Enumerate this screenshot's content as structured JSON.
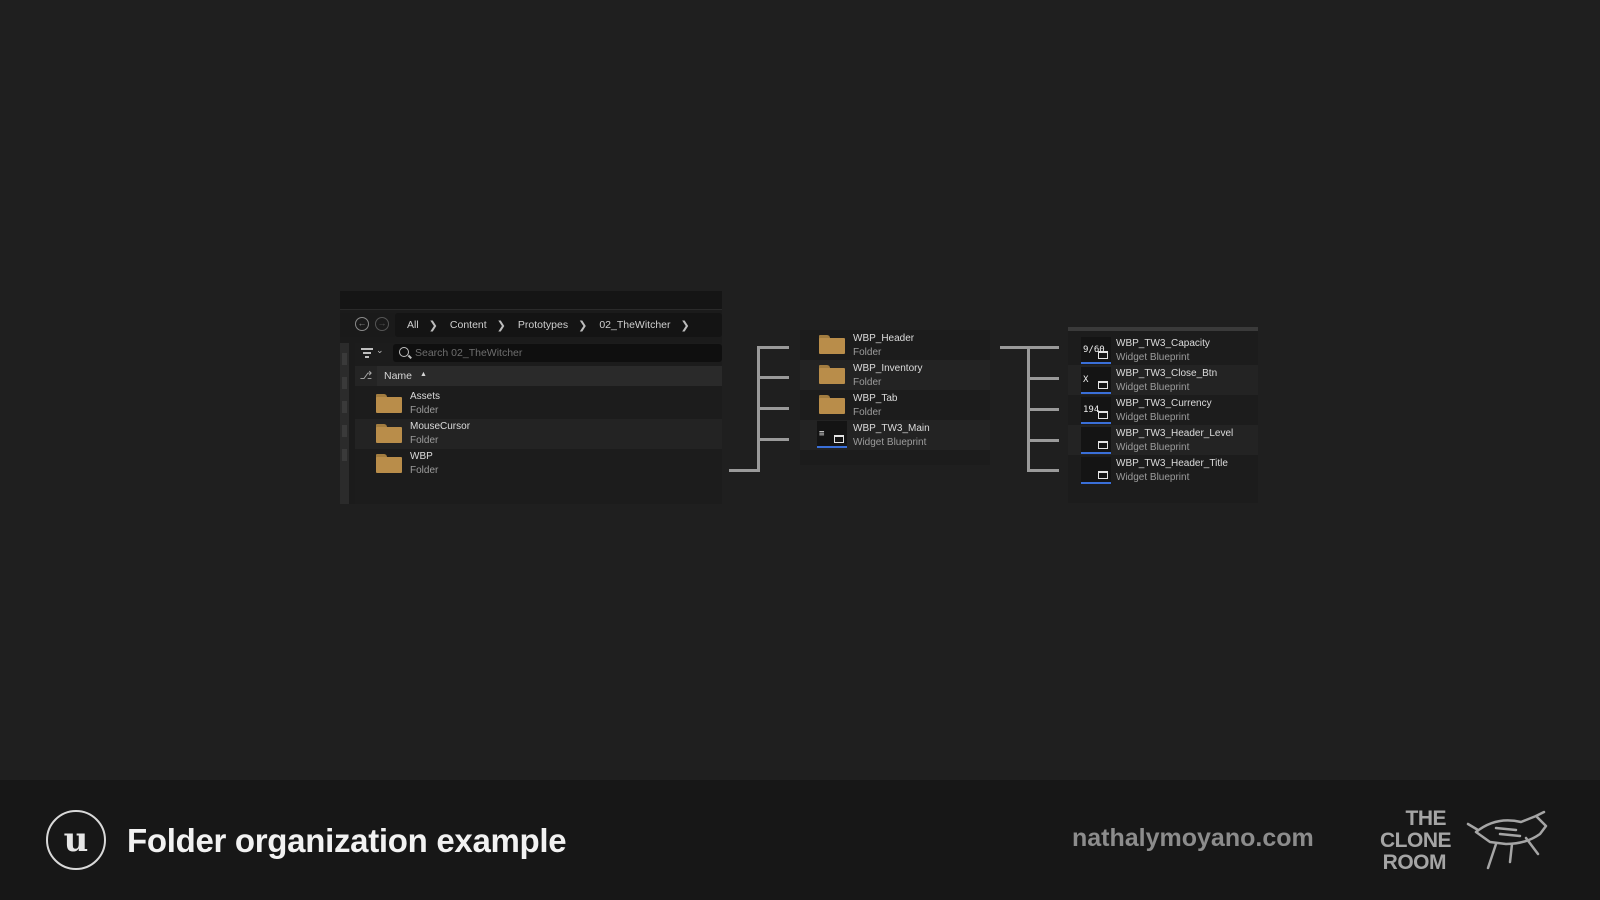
{
  "browser": {
    "breadcrumb": [
      "All",
      "Content",
      "Prototypes",
      "02_TheWitcher"
    ],
    "search_placeholder": "Search 02_TheWitcher",
    "column_header": "Name",
    "items": [
      {
        "name": "Assets",
        "type": "Folder"
      },
      {
        "name": "MouseCursor",
        "type": "Folder"
      },
      {
        "name": "WBP",
        "type": "Folder"
      }
    ]
  },
  "wbp_folder": {
    "items": [
      {
        "name": "WBP_Header",
        "type": "Folder",
        "icon": "folder-icon"
      },
      {
        "name": "WBP_Inventory",
        "type": "Folder",
        "icon": "folder-icon"
      },
      {
        "name": "WBP_Tab",
        "type": "Folder",
        "icon": "folder-icon"
      },
      {
        "name": "WBP_TW3_Main",
        "type": "Widget Blueprint",
        "icon": "widget-blueprint-icon"
      }
    ]
  },
  "header_folder": {
    "items": [
      {
        "name": "WBP_TW3_Capacity",
        "type": "Widget Blueprint",
        "thumb": "9/60"
      },
      {
        "name": "WBP_TW3_Close_Btn",
        "type": "Widget Blueprint",
        "thumb": "X"
      },
      {
        "name": "WBP_TW3_Currency",
        "type": "Widget Blueprint",
        "thumb": "194"
      },
      {
        "name": "WBP_TW3_Header_Level",
        "type": "Widget Blueprint",
        "thumb": ""
      },
      {
        "name": "WBP_TW3_Header_Title",
        "type": "Widget Blueprint",
        "thumb": ""
      }
    ]
  },
  "footer": {
    "title": "Folder organization example",
    "website": "nathalymoyano.com",
    "brand_lines": [
      "THE",
      "CLONE",
      "ROOM"
    ]
  },
  "colors": {
    "background": "#1f1f1f",
    "footer_background": "#171717",
    "folder": "#b98d4a",
    "widget_accent": "#3a6fd8"
  }
}
